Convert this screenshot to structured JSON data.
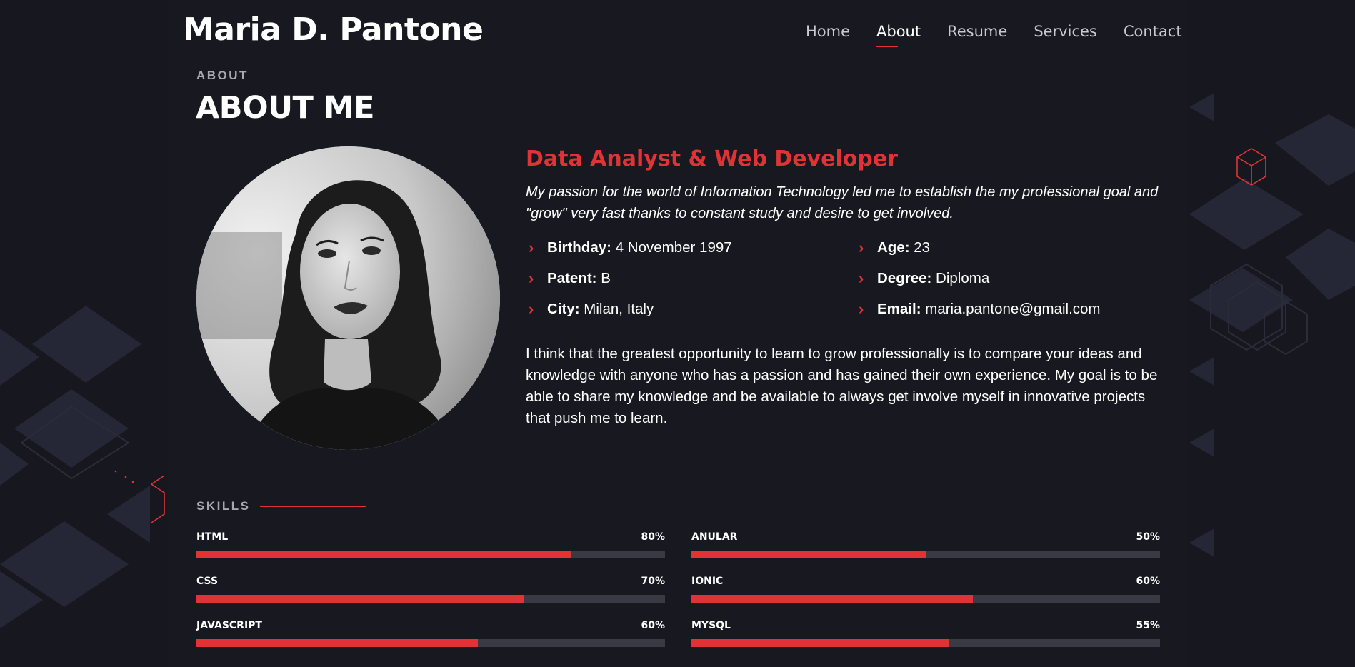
{
  "brand": {
    "name": "Maria D. Pantone"
  },
  "nav": {
    "items": [
      "Home",
      "About",
      "Resume",
      "Services",
      "Contact"
    ],
    "active": "About"
  },
  "about": {
    "eyebrow": "ABOUT",
    "title": "ABOUT ME",
    "role": "Data Analyst & Web Developer",
    "intro": "My passion for the world of Information Technology led me to establish the my professional goal and \"grow\" very fast thanks to constant study and desire to get involved.",
    "facts": [
      {
        "label": "Birthday:",
        "value": "4 November 1997"
      },
      {
        "label": "Age:",
        "value": "23"
      },
      {
        "label": "Patent:",
        "value": "B"
      },
      {
        "label": "Degree:",
        "value": "Diploma"
      },
      {
        "label": "City:",
        "value": "Milan, Italy"
      },
      {
        "label": "Email:",
        "value": "maria.pantone@gmail.com"
      }
    ],
    "bio": "I think that the greatest opportunity to learn to grow professionally is to compare your ideas and knowledge with anyone who has a passion and has gained their own experience. My goal is to be able to share my knowledge and be available to always get involve myself in innovative projects that push me to learn."
  },
  "skills": {
    "eyebrow": "SKILLS",
    "items": [
      {
        "name": "HTML",
        "percent_label": "80%",
        "level": 80
      },
      {
        "name": "ANULAR",
        "percent_label": "50%",
        "level": 50
      },
      {
        "name": "CSS",
        "percent_label": "70%",
        "level": 70
      },
      {
        "name": "IONIC",
        "percent_label": "60%",
        "level": 60
      },
      {
        "name": "JAVASCRIPT",
        "percent_label": "60%",
        "level": 60
      },
      {
        "name": "MYSQL",
        "percent_label": "55%",
        "level": 55
      }
    ]
  },
  "colors": {
    "accent": "#e03336",
    "background": "#17181f",
    "track": "#393a44"
  },
  "icons": [
    "chevron-right-icon",
    "cube-icon"
  ]
}
